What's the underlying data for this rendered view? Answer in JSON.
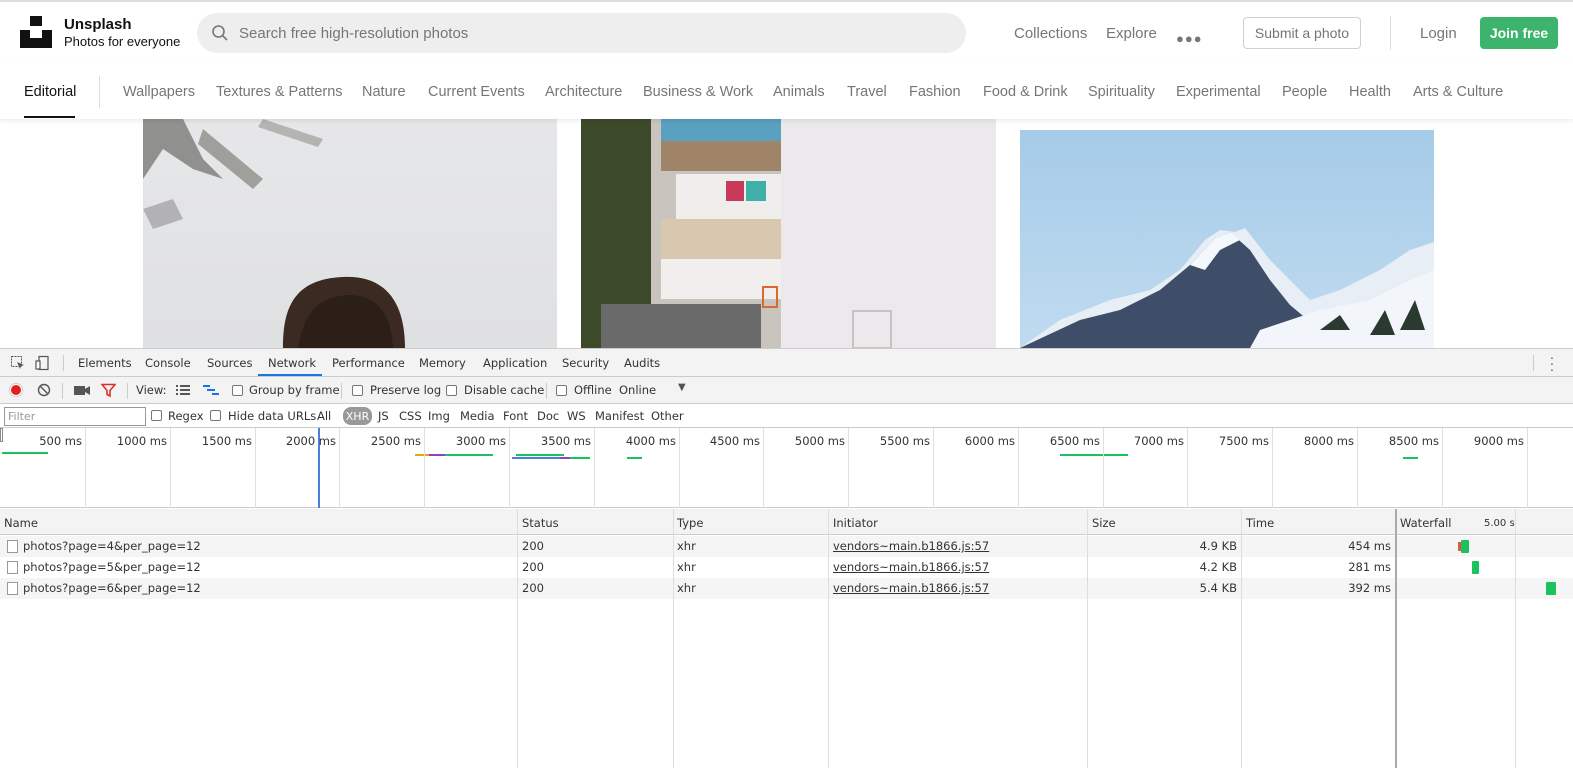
{
  "site": {
    "name": "Unsplash",
    "tagline": "Photos for everyone",
    "search_placeholder": "Search free high-resolution photos",
    "nav": [
      "Collections",
      "Explore"
    ],
    "submit_label": "Submit a photo",
    "login_label": "Login",
    "join_label": "Join free",
    "accent": "#3cb46e"
  },
  "topics": {
    "active": "Editorial",
    "items": [
      "Wallpapers",
      "Textures & Patterns",
      "Nature",
      "Current Events",
      "Architecture",
      "Business & Work",
      "Animals",
      "Travel",
      "Fashion",
      "Food & Drink",
      "Spirituality",
      "Experimental",
      "People",
      "Health",
      "Arts & Culture"
    ]
  },
  "devtools": {
    "tabs": [
      "Elements",
      "Console",
      "Sources",
      "Network",
      "Performance",
      "Memory",
      "Application",
      "Security",
      "Audits"
    ],
    "active_tab": "Network",
    "toolbar": {
      "view_label": "View:",
      "group_by_frame": "Group by frame",
      "preserve_log": "Preserve log",
      "disable_cache": "Disable cache",
      "offline": "Offline",
      "throttle": "Online"
    },
    "filter": {
      "placeholder": "Filter",
      "regex": "Regex",
      "hide_data_urls": "Hide data URLs",
      "types": [
        "All",
        "XHR",
        "JS",
        "CSS",
        "Img",
        "Media",
        "Font",
        "Doc",
        "WS",
        "Manifest",
        "Other"
      ],
      "active_type": "XHR"
    },
    "overview_ticks": [
      "500 ms",
      "1000 ms",
      "1500 ms",
      "2000 ms",
      "2500 ms",
      "3000 ms",
      "3500 ms",
      "4000 ms",
      "4500 ms",
      "5000 ms",
      "5500 ms",
      "6000 ms",
      "6500 ms",
      "7000 ms",
      "7500 ms",
      "8000 ms",
      "8500 ms",
      "9000 ms"
    ],
    "columns": [
      "Name",
      "Status",
      "Type",
      "Initiator",
      "Size",
      "Time",
      "Waterfall"
    ],
    "waterfall_scale": "5.00 s",
    "rows": [
      {
        "name": "photos?page=4&per_page=12",
        "status": "200",
        "type": "xhr",
        "initiator": "vendors~main.b1866.js:57",
        "size": "4.9 KB",
        "time": "454 ms"
      },
      {
        "name": "photos?page=5&per_page=12",
        "status": "200",
        "type": "xhr",
        "initiator": "vendors~main.b1866.js:57",
        "size": "4.2 KB",
        "time": "281 ms"
      },
      {
        "name": "photos?page=6&per_page=12",
        "status": "200",
        "type": "xhr",
        "initiator": "vendors~main.b1866.js:57",
        "size": "5.4 KB",
        "time": "392 ms"
      }
    ]
  }
}
